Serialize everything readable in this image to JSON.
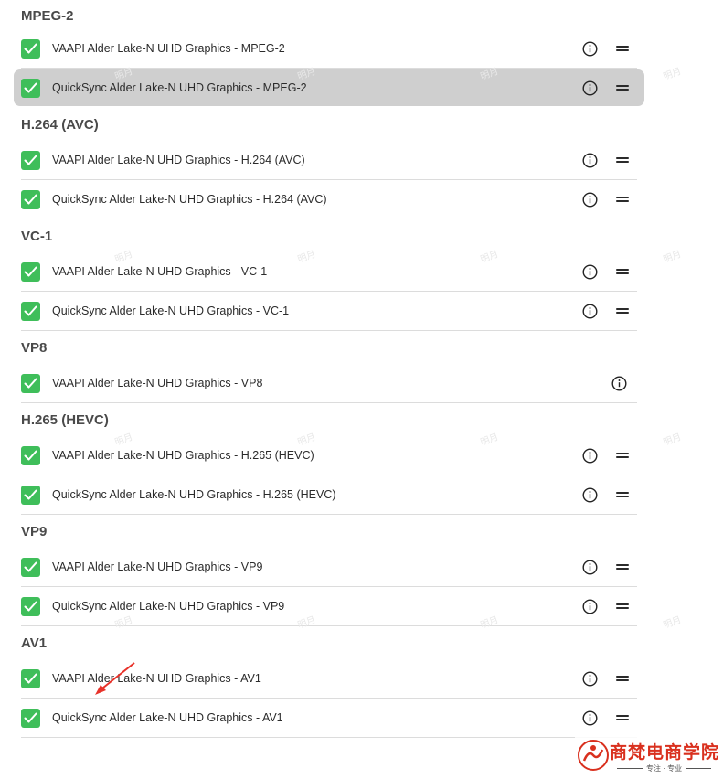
{
  "groups": [
    {
      "title": "MPEG-2",
      "rows": [
        {
          "label": "VAAPI Alder Lake-N UHD Graphics - MPEG-2",
          "checked": true,
          "selected": false,
          "drag": true
        },
        {
          "label": "QuickSync Alder Lake-N UHD Graphics - MPEG-2",
          "checked": true,
          "selected": true,
          "drag": true
        }
      ]
    },
    {
      "title": "H.264 (AVC)",
      "rows": [
        {
          "label": "VAAPI Alder Lake-N UHD Graphics - H.264 (AVC)",
          "checked": true,
          "selected": false,
          "drag": true
        },
        {
          "label": "QuickSync Alder Lake-N UHD Graphics - H.264 (AVC)",
          "checked": true,
          "selected": false,
          "drag": true
        }
      ]
    },
    {
      "title": "VC-1",
      "rows": [
        {
          "label": "VAAPI Alder Lake-N UHD Graphics - VC-1",
          "checked": true,
          "selected": false,
          "drag": true
        },
        {
          "label": "QuickSync Alder Lake-N UHD Graphics - VC-1",
          "checked": true,
          "selected": false,
          "drag": true
        }
      ]
    },
    {
      "title": "VP8",
      "rows": [
        {
          "label": "VAAPI Alder Lake-N UHD Graphics - VP8",
          "checked": true,
          "selected": false,
          "drag": false
        }
      ]
    },
    {
      "title": "H.265 (HEVC)",
      "rows": [
        {
          "label": "VAAPI Alder Lake-N UHD Graphics - H.265 (HEVC)",
          "checked": true,
          "selected": false,
          "drag": true
        },
        {
          "label": "QuickSync Alder Lake-N UHD Graphics - H.265 (HEVC)",
          "checked": true,
          "selected": false,
          "drag": true
        }
      ]
    },
    {
      "title": "VP9",
      "rows": [
        {
          "label": "VAAPI Alder Lake-N UHD Graphics - VP9",
          "checked": true,
          "selected": false,
          "drag": true
        },
        {
          "label": "QuickSync Alder Lake-N UHD Graphics - VP9",
          "checked": true,
          "selected": false,
          "drag": true
        }
      ]
    },
    {
      "title": "AV1",
      "rows": [
        {
          "label": "VAAPI Alder Lake-N UHD Graphics - AV1",
          "checked": true,
          "selected": false,
          "drag": true
        },
        {
          "label": "QuickSync Alder Lake-N UHD Graphics - AV1",
          "checked": true,
          "selected": false,
          "drag": true
        }
      ]
    }
  ],
  "icons": {
    "checkbox": "checkmark-icon",
    "info": "info-icon",
    "drag": "drag-handle-icon"
  },
  "colors": {
    "checkbox_fill": "#3fbe5a",
    "selected_row_bg": "#cfcfcf",
    "annotation_arrow": "#e8322a",
    "logo_red": "#d9301e"
  },
  "watermark_text": "明月",
  "logo": {
    "text": "商梵电商学院",
    "subtext": "专注 · 专业"
  }
}
